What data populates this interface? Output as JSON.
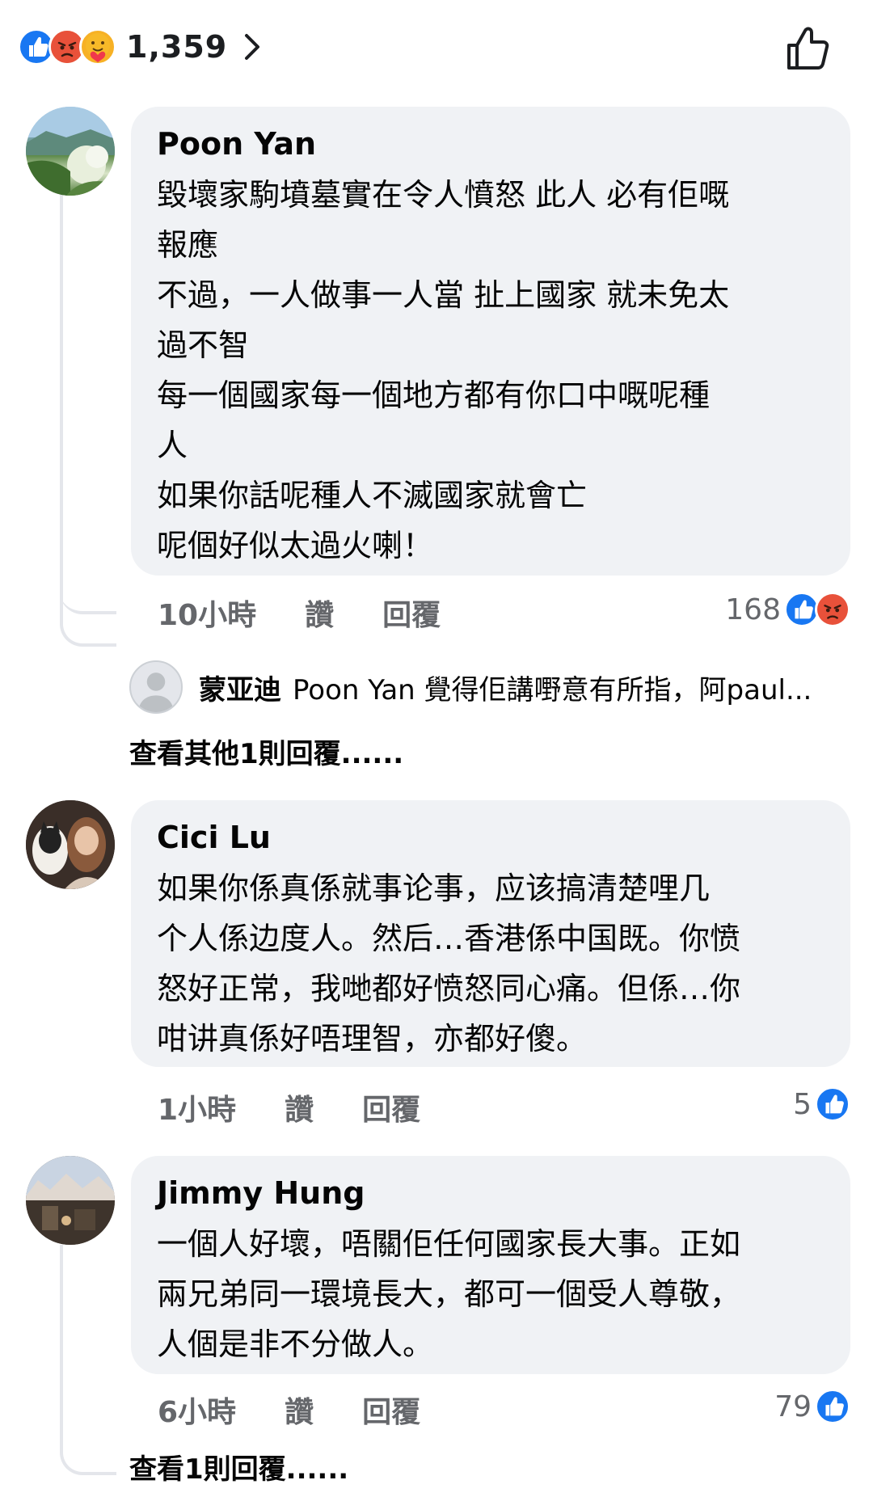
{
  "top": {
    "reaction_icons": [
      "like-icon",
      "angry-icon",
      "care-icon"
    ],
    "count": "1,359"
  },
  "colors": {
    "like_blue": "#1877f2",
    "angry_orange": "#f0743b",
    "bubble_gray": "#f0f2f5",
    "meta_gray": "#65676b"
  },
  "comments": [
    {
      "author": "Poon Yan",
      "text": "毀壞家駒墳墓實在令人憤怒 此人 必有佢嘅\n報應\n不過，一人做事一人當 扯上國家 就未免太\n過不智\n每一個國家每一個地方都有你口中嘅呢種\n人\n如果你話呢種人不滅國家就會亡\n呢個好似太過火喇！",
      "time": "10小時",
      "like_label": "讚",
      "reply_label": "回覆",
      "reaction_count": "168",
      "reactions": [
        "like-icon",
        "angry-icon"
      ],
      "reply": {
        "author": "蒙亚迪",
        "text": "Poon Yan 覺得佢講嘢意有所指，阿paul..."
      },
      "more_replies": "查看其他1則回覆......"
    },
    {
      "author": "Cici Lu",
      "text": "如果你係真係就事论事，应该搞清楚哩几\n个人係边度人。然后…香港係中国既。你愤\n怒好正常，我哋都好愤怒同心痛。但係…你\n咁讲真係好唔理智，亦都好傻。",
      "time": "1小時",
      "like_label": "讚",
      "reply_label": "回覆",
      "reaction_count": "5",
      "reactions": [
        "like-icon"
      ]
    },
    {
      "author": "Jimmy Hung",
      "text": "一個人好壞，唔關佢任何國家長大事。正如\n兩兄弟同一環境長大，都可一個受人尊敬，\n人個是非不分做人。",
      "time": "6小時",
      "like_label": "讚",
      "reply_label": "回覆",
      "reaction_count": "79",
      "reactions": [
        "like-icon"
      ],
      "more_replies": "查看1則回覆......"
    }
  ]
}
